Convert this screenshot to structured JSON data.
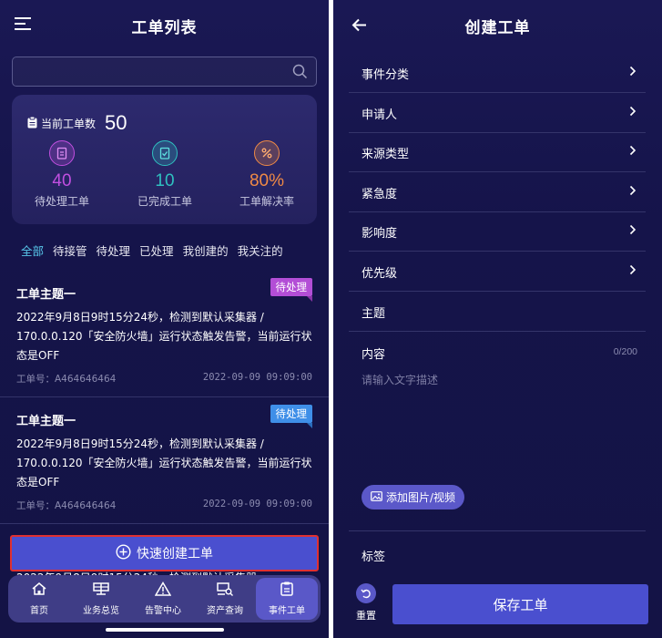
{
  "left": {
    "title": "工单列表",
    "search": {
      "value": "",
      "placeholder": ""
    },
    "stats": {
      "current_label": "当前工单数",
      "current_value": "50",
      "items": [
        {
          "value": "40",
          "label": "待处理工单",
          "color": "#c14fe0"
        },
        {
          "value": "10",
          "label": "已完成工单",
          "color": "#2fc0c0"
        },
        {
          "value": "80%",
          "label": "工单解决率",
          "color": "#f08a45"
        }
      ]
    },
    "tabs": [
      "全部",
      "待接管",
      "待处理",
      "已处理",
      "我创建的",
      "我关注的"
    ],
    "active_tab": "全部",
    "tickets": [
      {
        "subject": "工单主题一",
        "badge": "待处理",
        "badge_color": "#b34ed6",
        "desc": "2022年9月8日9时15分24秒，检测到默认采集器 / 170.0.0.120「安全防火墙」运行状态触发告警，当前运行状态是OFF",
        "ticket_no": "工单号：A464646464",
        "time": "2022-09-09 09:09:00"
      },
      {
        "subject": "工单主题一",
        "badge": "待处理",
        "badge_color": "#3f8fe8",
        "desc": "2022年9月8日9时15分24秒，检测到默认采集器 / 170.0.0.120「安全防火墙」运行状态触发告警，当前运行状态是OFF",
        "ticket_no": "工单号：A464646464",
        "time": "2022-09-09 09:09:00"
      },
      {
        "subject": "",
        "badge": "",
        "badge_color": "#3f8fe8",
        "desc": "2022年9月8日9时15分24秒，检测到默认采集器",
        "ticket_no": "",
        "time": ""
      }
    ],
    "quick_create": "快速创建工单",
    "nav": [
      {
        "label": "首页",
        "icon": "home-icon"
      },
      {
        "label": "业务总览",
        "icon": "overview-icon"
      },
      {
        "label": "告警中心",
        "icon": "alert-icon"
      },
      {
        "label": "资产查询",
        "icon": "asset-search-icon"
      },
      {
        "label": "事件工单",
        "icon": "clipboard-icon"
      }
    ],
    "active_nav": "事件工单"
  },
  "right": {
    "title": "创建工单",
    "rows": [
      "事件分类",
      "申请人",
      "来源类型",
      "紧急度",
      "影响度",
      "优先级"
    ],
    "subject_label": "主题",
    "content_label": "内容",
    "counter": "0/200",
    "content_placeholder": "请输入文字描述",
    "add_media": "添加图片/视频",
    "tags_label": "标签",
    "reset": "重置",
    "save": "保存工单"
  }
}
